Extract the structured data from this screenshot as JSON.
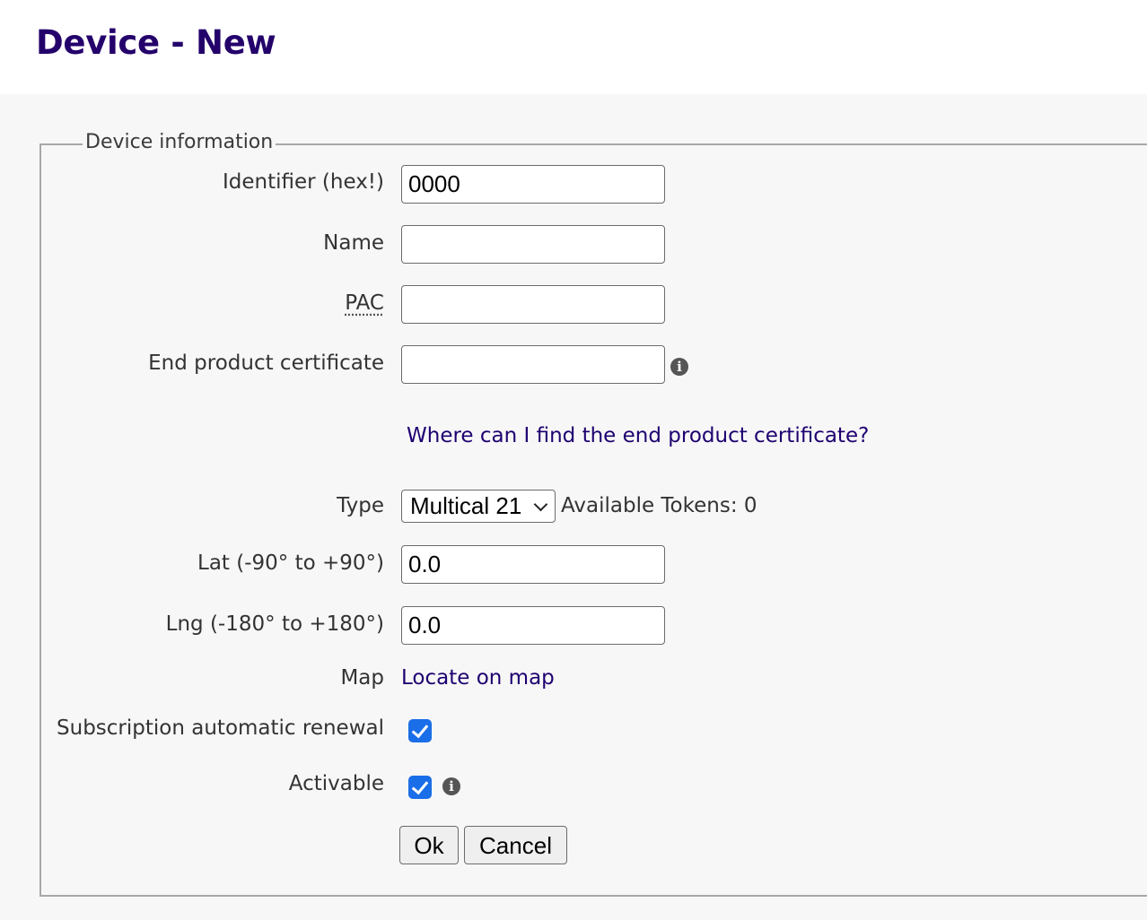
{
  "page": {
    "title": "Device - New"
  },
  "form": {
    "legend": "Device information",
    "identifier": {
      "label": "Identifier (hex!)",
      "value": "0000"
    },
    "name": {
      "label": "Name",
      "value": ""
    },
    "pac": {
      "label": "PAC",
      "value": ""
    },
    "end_product_certificate": {
      "label": "End product certificate",
      "value": "",
      "help_link": "Where can I find the end product certificate?"
    },
    "type": {
      "label": "Type",
      "selected": "Multical 21",
      "available_tokens": "Available Tokens: 0"
    },
    "lat": {
      "label": "Lat (-90° to +90°)",
      "value": "0.0"
    },
    "lng": {
      "label": "Lng (-180° to +180°)",
      "value": "0.0"
    },
    "map": {
      "label": "Map",
      "link": "Locate on map"
    },
    "subscription_renewal": {
      "label": "Subscription automatic renewal",
      "checked": true
    },
    "activable": {
      "label": "Activable",
      "checked": true
    },
    "buttons": {
      "ok": "Ok",
      "cancel": "Cancel"
    }
  },
  "icons": {
    "info": "info-circle-icon",
    "checkbox": "checkmark-icon",
    "dropdown": "chevron-down-icon"
  },
  "colors": {
    "title": "#24006b",
    "link": "#1e0070",
    "checkbox": "#1a6ee8",
    "content_background": "#f7f7f7"
  }
}
